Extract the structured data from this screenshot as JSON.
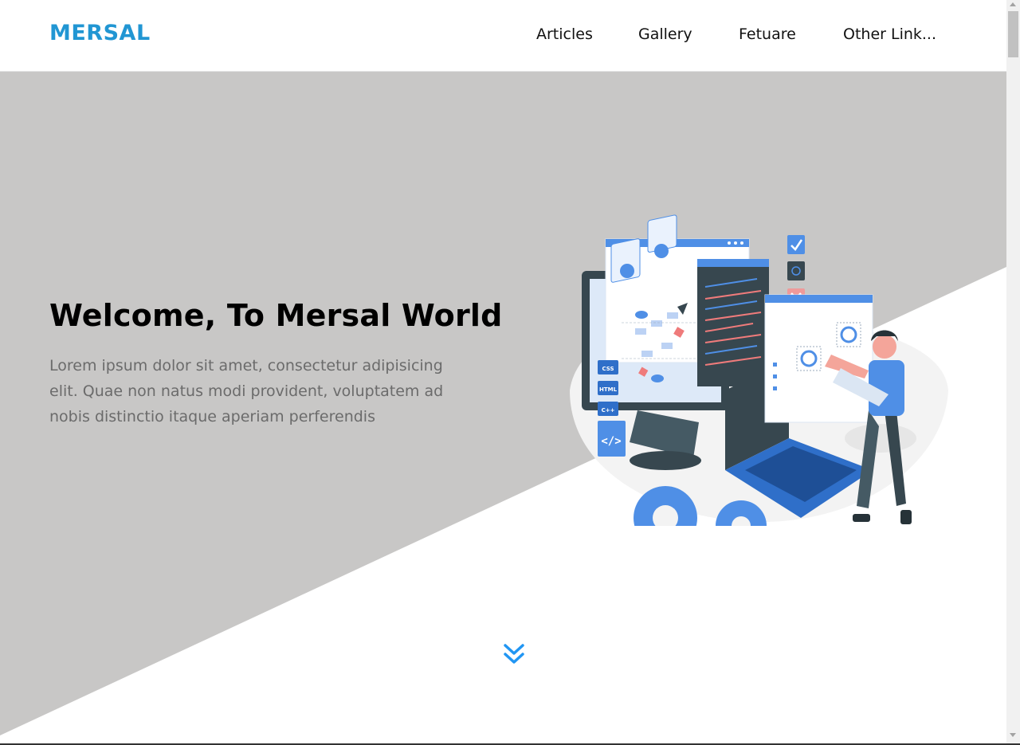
{
  "brand": {
    "name": "MERSAL",
    "color": "#2196d3"
  },
  "nav": {
    "items": [
      {
        "label": "Articles"
      },
      {
        "label": "Gallery"
      },
      {
        "label": "Fetuare"
      },
      {
        "label": "Other Link..."
      }
    ]
  },
  "hero": {
    "title": "Welcome, To Mersal World",
    "text": "Lorem ipsum dolor sit amet, consectetur adipisicing elit. Quae non natus modi provident, voluptatem ad nobis distinctio itaque aperiam perferendis",
    "background_color": "#c8c7c6",
    "illustration": {
      "code_tags": [
        "CSS",
        "HTML",
        "C++"
      ],
      "code_icon": "</>"
    }
  },
  "scroll_down_icon": "double-chevron-down-icon",
  "accent_color": "#2196f3"
}
